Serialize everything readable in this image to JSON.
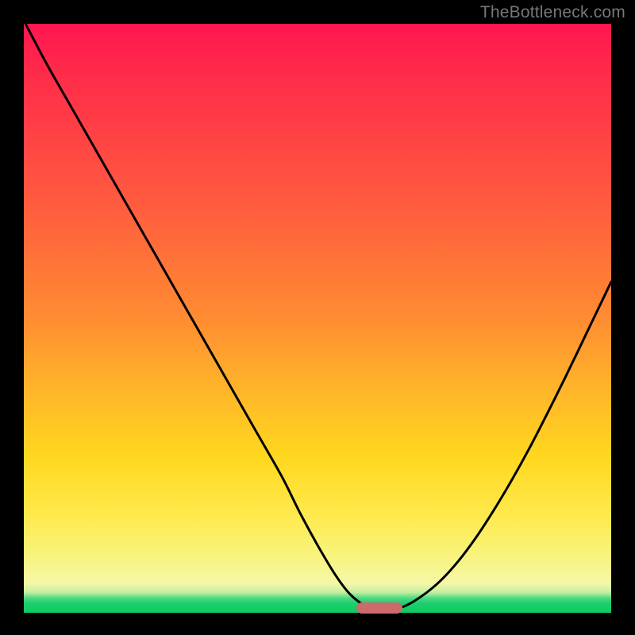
{
  "watermark": "TheBottleneck.com",
  "chart_data": {
    "type": "line",
    "title": "",
    "xlabel": "",
    "ylabel": "",
    "xlim": [
      0,
      100
    ],
    "ylim": [
      0,
      100
    ],
    "grid": false,
    "legend": false,
    "series": [
      {
        "name": "left-arm",
        "x": [
          0.3,
          4,
          8,
          12,
          16,
          20,
          24,
          28,
          32,
          36,
          40,
          44,
          47,
          50,
          53,
          55.5,
          58,
          60
        ],
        "y": [
          100,
          93,
          86,
          79,
          72,
          65,
          58,
          51,
          44,
          37,
          30,
          23,
          17,
          11.5,
          6.5,
          3.2,
          1.2,
          0.3
        ]
      },
      {
        "name": "right-arm",
        "x": [
          62,
          65,
          68,
          71,
          74,
          77,
          80,
          83,
          86,
          89,
          92,
          95,
          97.5,
          100
        ],
        "y": [
          0.3,
          1.2,
          3.0,
          5.5,
          8.8,
          12.8,
          17.4,
          22.4,
          27.8,
          33.6,
          39.6,
          45.8,
          51.0,
          56.2
        ]
      }
    ],
    "gradient_stops": [
      {
        "pos_pct": 0,
        "color": "#ff1650"
      },
      {
        "pos_pct": 30,
        "color": "#ff5a3f"
      },
      {
        "pos_pct": 50,
        "color": "#ff8c32"
      },
      {
        "pos_pct": 73.5,
        "color": "#ffd71f"
      },
      {
        "pos_pct": 90,
        "color": "#f8f37a"
      },
      {
        "pos_pct": 97.5,
        "color": "#4fd982"
      },
      {
        "pos_pct": 100,
        "color": "#0ecb65"
      }
    ],
    "marker": {
      "name": "optimal-marker",
      "x_pct": 60.5,
      "y_pct": 0.2,
      "width_pct": 7.8,
      "color": "#cc6a6c"
    }
  },
  "colors": {
    "frame_bg": "#000000",
    "curve": "#000000",
    "watermark": "#777777"
  }
}
